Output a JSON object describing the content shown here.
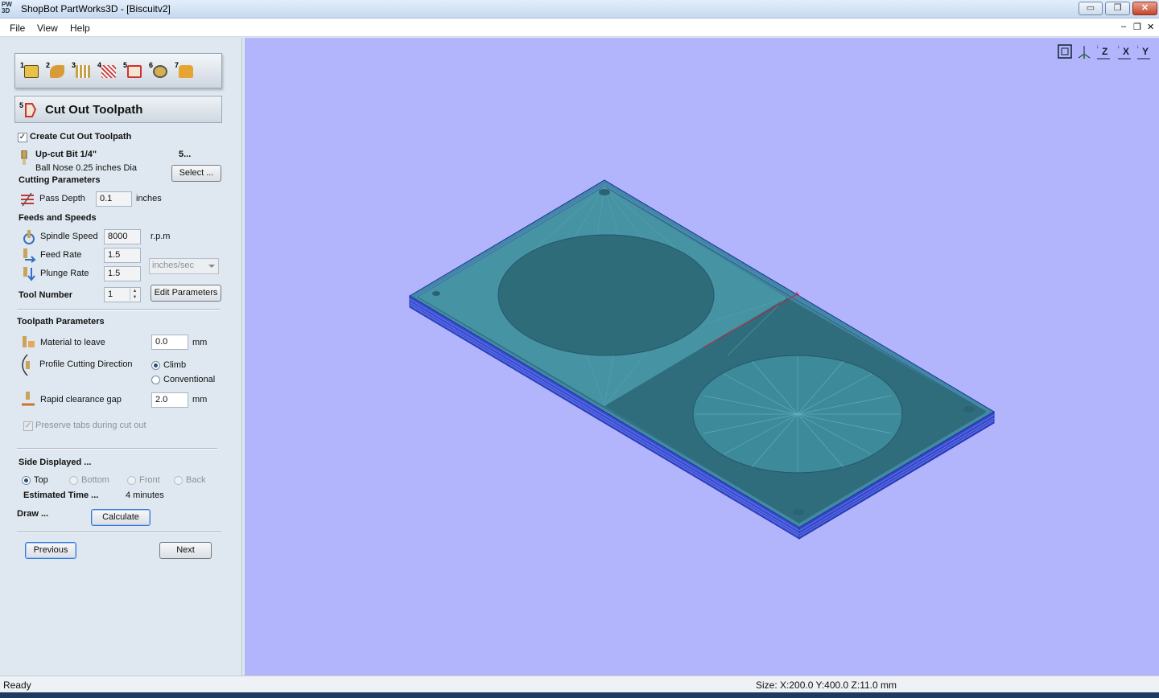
{
  "window": {
    "app_icon": "PW\n3D",
    "title": "ShopBot PartWorks3D - [Biscuitv2]",
    "minimize_glyph": "▭",
    "maximize_glyph": "❐",
    "close_glyph": "✕"
  },
  "menu": {
    "file": "File",
    "view": "View",
    "help": "Help",
    "mdi_minimize": "–",
    "mdi_restore": "❐",
    "mdi_close": "✕"
  },
  "steps": [
    {
      "num": "1",
      "icon": "cube-icon"
    },
    {
      "num": "2",
      "icon": "material-icon"
    },
    {
      "num": "3",
      "icon": "roughing-icon"
    },
    {
      "num": "4",
      "icon": "finishing-icon"
    },
    {
      "num": "5",
      "icon": "cutout-icon"
    },
    {
      "num": "6",
      "icon": "preview-icon"
    },
    {
      "num": "7",
      "icon": "save-toolpath-icon"
    }
  ],
  "panel": {
    "header_num": "5",
    "title": "Cut Out Toolpath",
    "create_label": "Create Cut Out Toolpath",
    "create_checked": "✓",
    "tool_name": "Up-cut Bit 1/4\"",
    "tool_number_short": "5...",
    "tool_desc": "Ball Nose 0.25 inches Dia",
    "select_button": "Select ...",
    "cutting_params": "Cutting Parameters",
    "pass_depth_label": "Pass Depth",
    "pass_depth_value": "0.1",
    "pass_depth_unit": "inches",
    "feeds_speeds": "Feeds and Speeds",
    "spindle_label": "Spindle Speed",
    "spindle_value": "8000",
    "spindle_unit": "r.p.m",
    "feed_label": "Feed Rate",
    "feed_value": "1.5",
    "plunge_label": "Plunge Rate",
    "plunge_value": "1.5",
    "rate_units": "inches/sec",
    "tool_number_label": "Tool Number",
    "tool_number_value": "1",
    "edit_params_button": "Edit Parameters",
    "toolpath_params": "Toolpath Parameters",
    "material_label": "Material to leave",
    "material_value": "0.0",
    "material_unit": "mm",
    "direction_label": "Profile Cutting Direction",
    "climb_label": "Climb",
    "conventional_label": "Conventional",
    "rapid_label": "Rapid clearance gap",
    "rapid_value": "2.0",
    "rapid_unit": "mm",
    "preserve_label": "Preserve tabs during cut out",
    "preserve_checked": "✓",
    "side_displayed": "Side Displayed ...",
    "side_top": "Top",
    "side_bottom": "Bottom",
    "side_front": "Front",
    "side_back": "Back",
    "estimated_label": "Estimated Time ...",
    "estimated_value": "4 minutes",
    "draw_label": "Draw ...",
    "calculate_button": "Calculate",
    "previous_button": "Previous",
    "next_button": "Next"
  },
  "view_tools": [
    {
      "icon": "zoom-extents-icon",
      "label": "⊡"
    },
    {
      "icon": "iso-view-icon",
      "label": "⊥"
    },
    {
      "icon": "view-z-icon",
      "label": "Z"
    },
    {
      "icon": "view-x-icon",
      "label": "X"
    },
    {
      "icon": "view-y-icon",
      "label": "Y"
    }
  ],
  "status": {
    "left": "Ready",
    "size": "Size: X:200.0 Y:400.0 Z:11.0 mm"
  },
  "colors": {
    "viewport_bg": "#b2b5fc",
    "model_face": "#3f8a9c",
    "model_dark": "#2f6d7c",
    "model_edge": "#1f2fa8"
  }
}
